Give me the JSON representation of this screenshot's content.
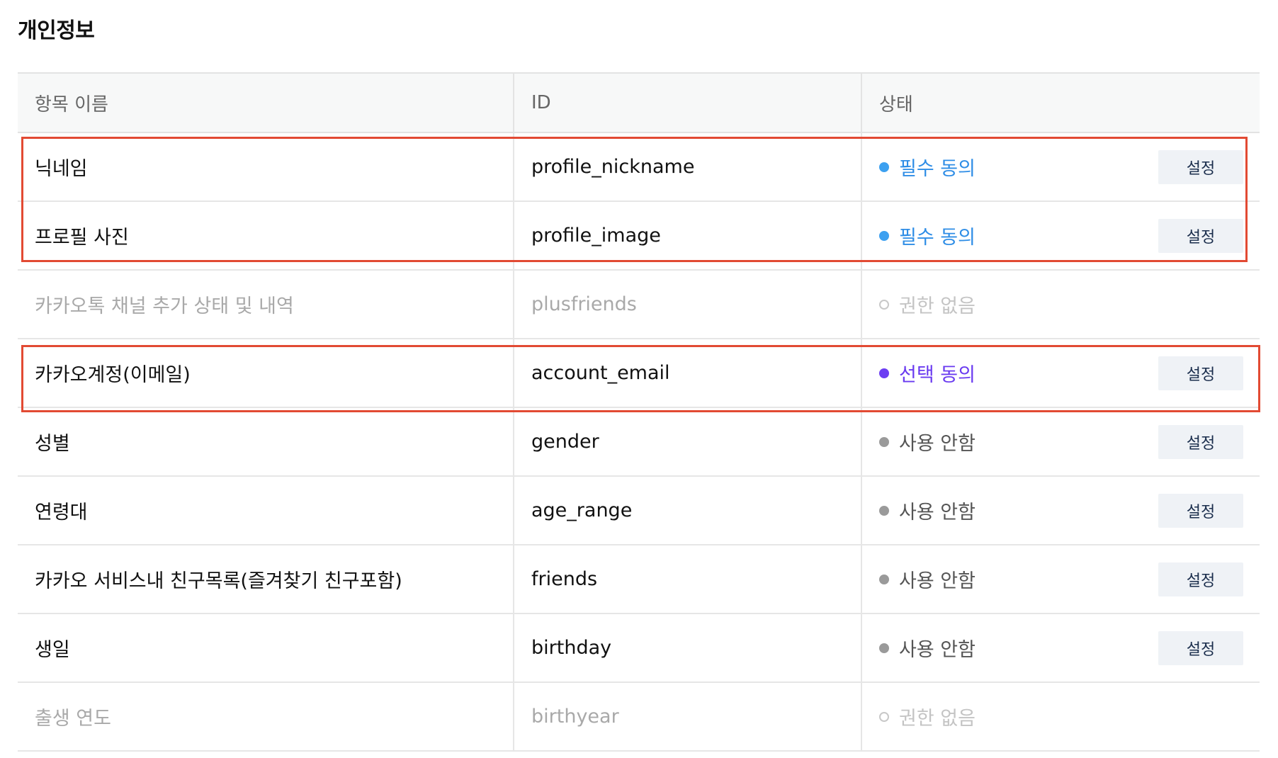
{
  "section": {
    "title": "개인정보"
  },
  "table": {
    "headers": {
      "name": "항목 이름",
      "id": "ID",
      "status": "상태"
    },
    "button_label": "설정",
    "rows": [
      {
        "name": "닉네임",
        "id": "profile_nickname",
        "status": "필수 동의",
        "status_type": "required",
        "has_button": true
      },
      {
        "name": "프로필 사진",
        "id": "profile_image",
        "status": "필수 동의",
        "status_type": "required",
        "has_button": true
      },
      {
        "name": "카카오톡 채널 추가 상태 및 내역",
        "id": "plusfriends",
        "status": "권한 없음",
        "status_type": "none",
        "has_button": false
      },
      {
        "name": "카카오계정(이메일)",
        "id": "account_email",
        "status": "선택 동의",
        "status_type": "optional",
        "has_button": true
      },
      {
        "name": "성별",
        "id": "gender",
        "status": "사용 안함",
        "status_type": "unused",
        "has_button": true
      },
      {
        "name": "연령대",
        "id": "age_range",
        "status": "사용 안함",
        "status_type": "unused",
        "has_button": true
      },
      {
        "name": "카카오 서비스내 친구목록(즐겨찾기 친구포함)",
        "id": "friends",
        "status": "사용 안함",
        "status_type": "unused",
        "has_button": true
      },
      {
        "name": "생일",
        "id": "birthday",
        "status": "사용 안함",
        "status_type": "unused",
        "has_button": true
      },
      {
        "name": "출생 연도",
        "id": "birthyear",
        "status": "권한 없음",
        "status_type": "none",
        "has_button": false
      }
    ]
  },
  "colors": {
    "required": "#3ca0f0",
    "optional": "#6c3df2",
    "unused": "#9a9a9a",
    "none": "#c8c8c8",
    "highlight": "#e24a33"
  }
}
